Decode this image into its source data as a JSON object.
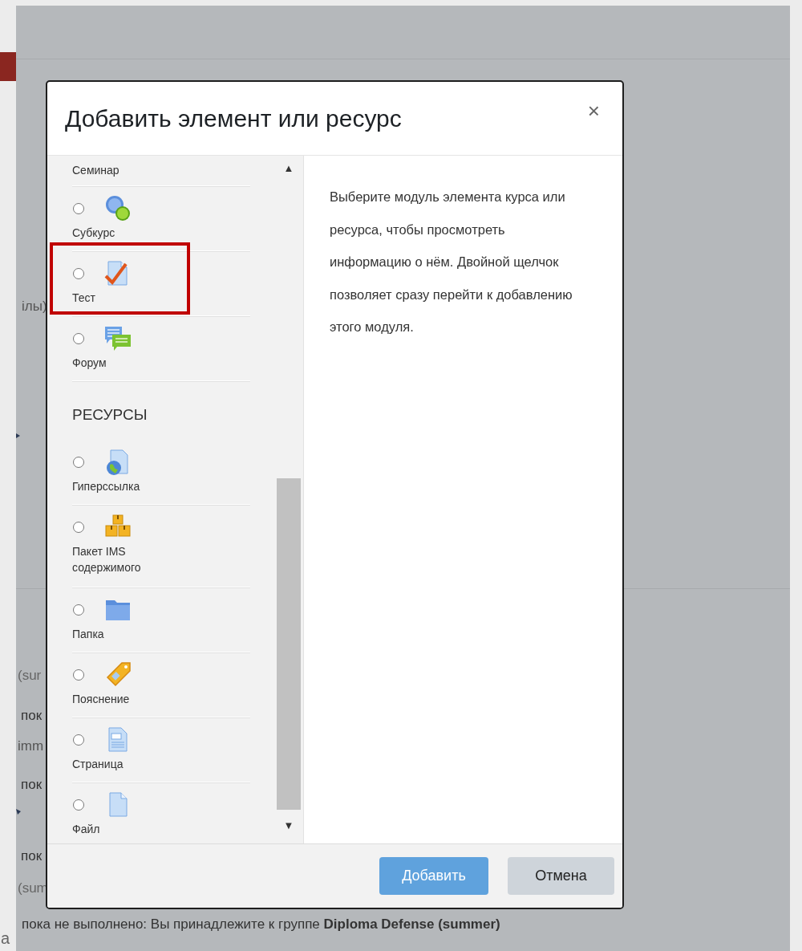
{
  "background_page": {
    "fragments": [
      "ілы)",
      "(sur",
      "пок",
      "imm",
      "пок",
      "пок",
      "(sum"
    ],
    "outside_text": "а",
    "restriction_line": "пока не выполнено: Вы принадлежите к группе **Diploma Defense (summer)**"
  },
  "dialog": {
    "title": "Добавить элемент или ресурс",
    "close": "×",
    "modules": [
      {
        "kind": "partial",
        "label": "Семинар"
      },
      {
        "kind": "module",
        "label": "Субкурс",
        "selected": false
      },
      {
        "kind": "module",
        "label": "Тест",
        "selected": false
      },
      {
        "kind": "module",
        "label": "Форум",
        "selected": false
      },
      {
        "kind": "heading",
        "label": "РЕСУРСЫ"
      },
      {
        "kind": "module",
        "label": "Гиперссылка",
        "selected": false
      },
      {
        "kind": "module",
        "label": "Пакет IMS содержимого",
        "selected": false
      },
      {
        "kind": "module",
        "label": "Папка",
        "selected": false
      },
      {
        "kind": "module",
        "label": "Пояснение",
        "selected": false
      },
      {
        "kind": "module",
        "label": "Страница",
        "selected": false
      },
      {
        "kind": "module",
        "label": "Файл",
        "selected": false
      }
    ],
    "scroll_up": "▲",
    "scroll_down": "▼",
    "help_text": "Выберите модуль элемента курса или ресурса, чтобы просмотреть информацию о нём. Двойной щелчок позволяет сразу перейти к добавлению этого модуля.",
    "buttons": [
      {
        "kind": "primary",
        "label": "Добавить"
      },
      {
        "kind": "secondary",
        "label": "Отмена"
      }
    ]
  }
}
